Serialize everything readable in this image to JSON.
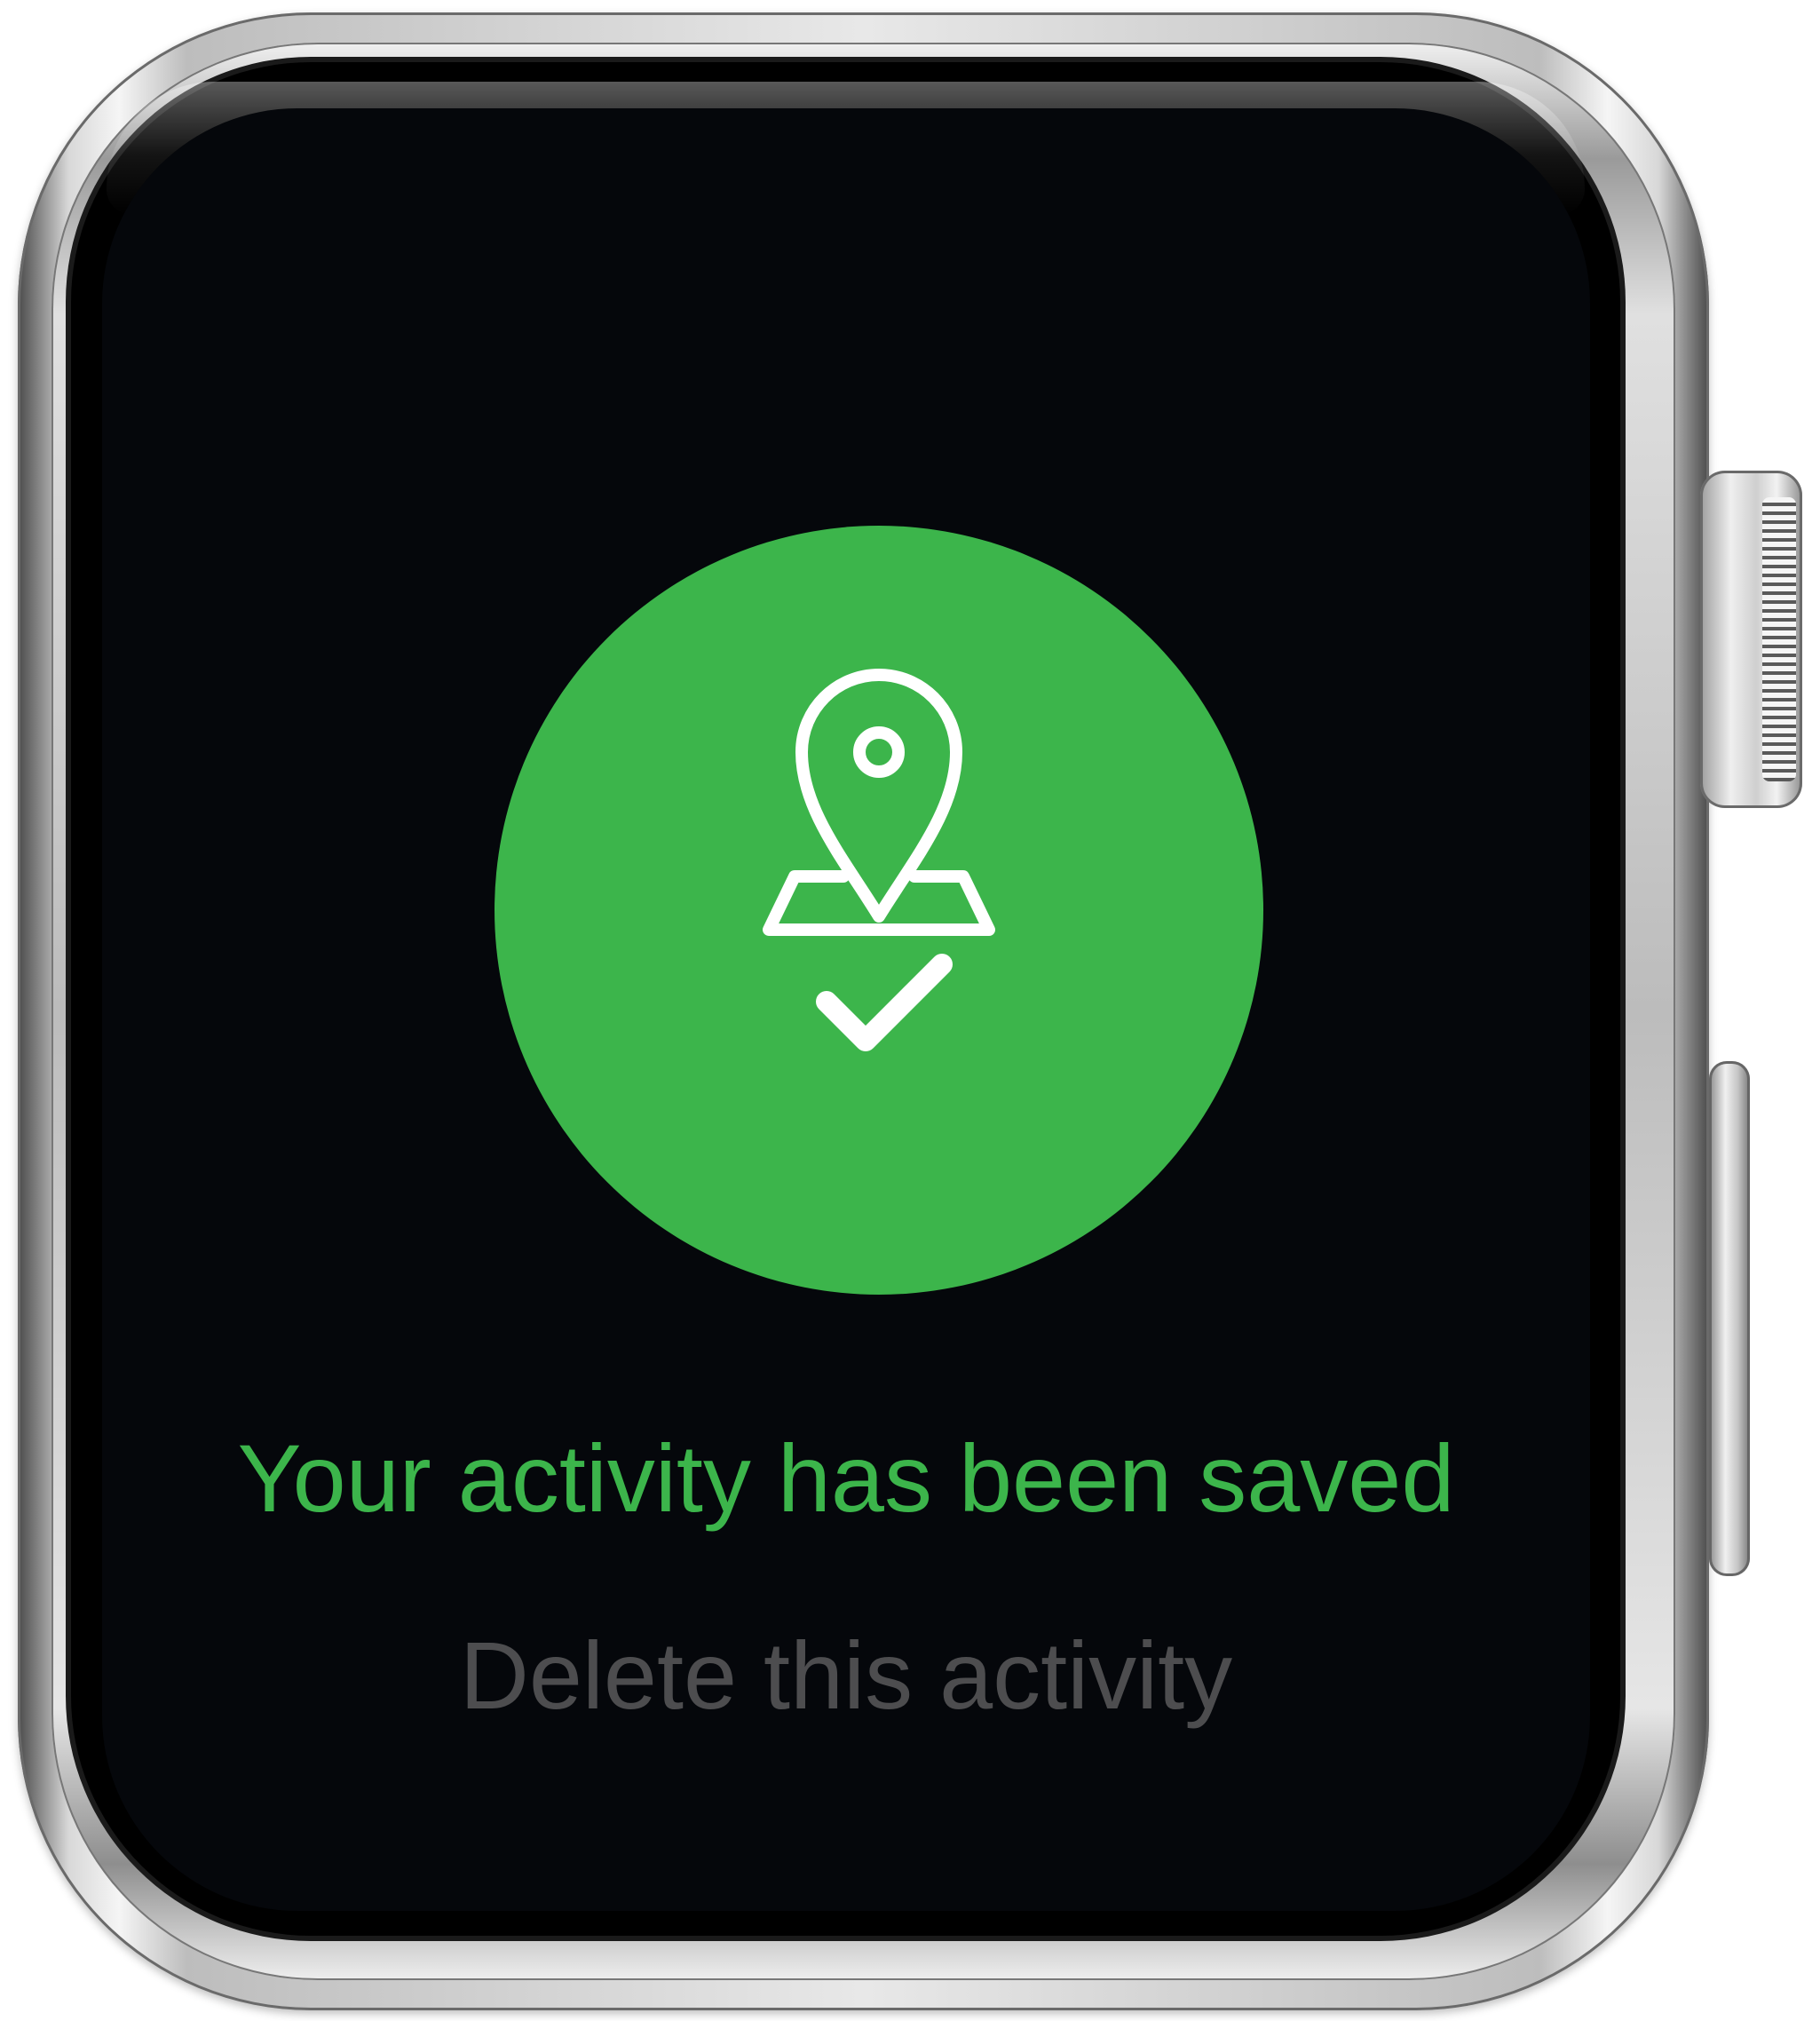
{
  "device": {
    "type": "smartwatch"
  },
  "status_badge": {
    "color": "#3cb54b",
    "icons": [
      "map-pin-icon",
      "checkmark-icon"
    ]
  },
  "screen": {
    "saved_message": "Your activity has been saved",
    "delete_action": "Delete this activity"
  },
  "colors": {
    "accent": "#3cb54b",
    "background": "#05070b",
    "muted_text": "#4d4d4f",
    "icon_stroke": "#ffffff"
  }
}
